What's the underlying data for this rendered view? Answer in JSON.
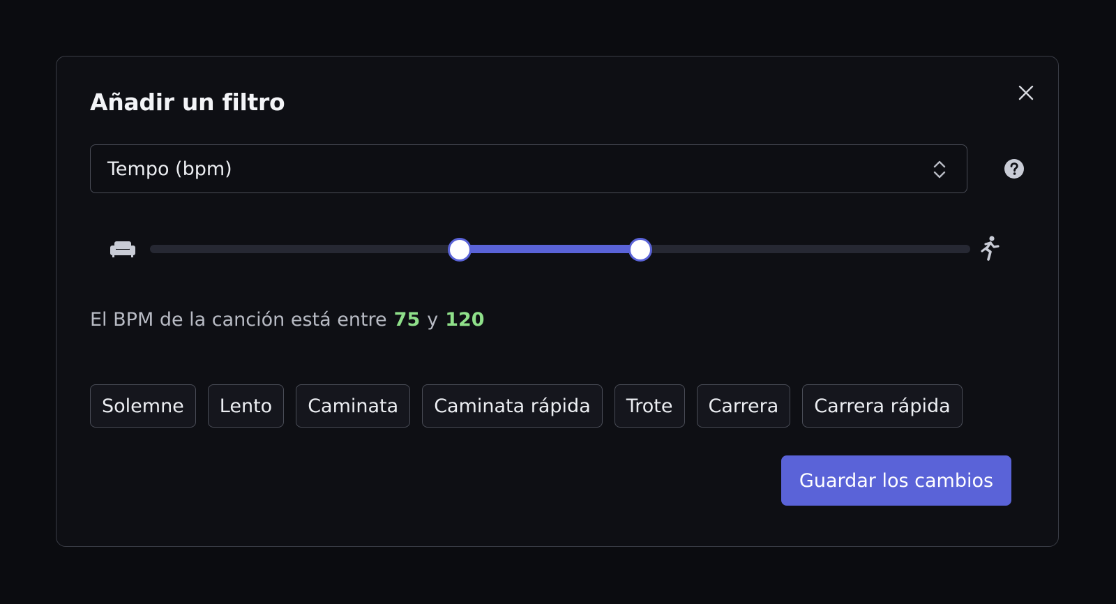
{
  "modal": {
    "title": "Añadir un filtro",
    "close_icon": "close-icon",
    "help_icon": "question-circle-icon"
  },
  "filter_select": {
    "selected": "Tempo (bpm)",
    "icon": "chevron-up-down-icon"
  },
  "tempo_slider": {
    "min_icon": "couch-icon",
    "max_icon": "running-person-icon",
    "range_start_fraction": 0.377,
    "range_end_fraction": 0.597,
    "accent_color": "#5a63d8"
  },
  "summary": {
    "text": "El BPM de la canción está entre",
    "low": "75",
    "conjunction": "y",
    "high": "120",
    "value_color": "#8fe08a"
  },
  "presets": [
    "Solemne",
    "Lento",
    "Caminata",
    "Caminata rápida",
    "Trote",
    "Carrera",
    "Carrera rápida"
  ],
  "actions": {
    "save_label": "Guardar los cambios",
    "save_color": "#5a63d8"
  }
}
